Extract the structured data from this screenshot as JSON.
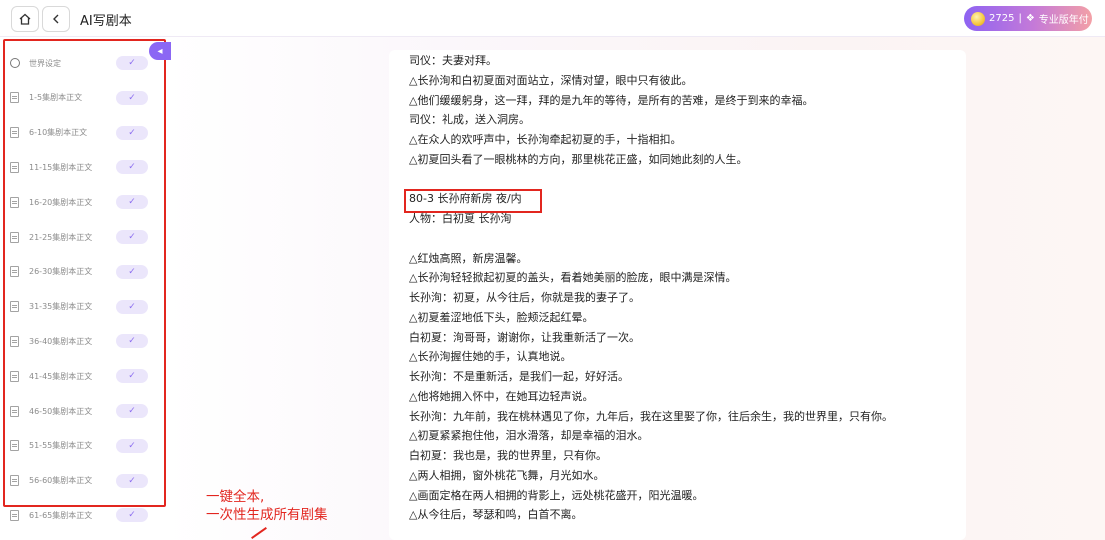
{
  "header": {
    "title": "AI写剧本",
    "home_icon": "home-icon",
    "back_icon": "chevron-left-icon",
    "badge_count": "2725",
    "badge_sep": "|",
    "badge_plan": "专业版年付"
  },
  "sidebar": {
    "items": [
      {
        "label": "世界设定",
        "icon": "world-icon",
        "checked": true
      },
      {
        "label": "1-5集剧本正文",
        "icon": "doc-icon",
        "checked": true
      },
      {
        "label": "6-10集剧本正文",
        "icon": "doc-icon",
        "checked": true
      },
      {
        "label": "11-15集剧本正文",
        "icon": "doc-icon",
        "checked": true
      },
      {
        "label": "16-20集剧本正文",
        "icon": "doc-icon",
        "checked": true
      },
      {
        "label": "21-25集剧本正文",
        "icon": "doc-icon",
        "checked": true
      },
      {
        "label": "26-30集剧本正文",
        "icon": "doc-icon",
        "checked": true
      },
      {
        "label": "31-35集剧本正文",
        "icon": "doc-icon",
        "checked": true
      },
      {
        "label": "36-40集剧本正文",
        "icon": "doc-icon",
        "checked": true
      },
      {
        "label": "41-45集剧本正文",
        "icon": "doc-icon",
        "checked": true
      },
      {
        "label": "46-50集剧本正文",
        "icon": "doc-icon",
        "checked": true
      },
      {
        "label": "51-55集剧本正文",
        "icon": "doc-icon",
        "checked": true
      },
      {
        "label": "56-60集剧本正文",
        "icon": "doc-icon",
        "checked": true
      },
      {
        "label": "61-65集剧本正文",
        "icon": "doc-icon",
        "checked": true
      }
    ],
    "check_glyph": "✓",
    "collapse_glyph": "◂"
  },
  "annotation": {
    "line1": "一键全本,",
    "line2": "一次性生成所有剧集"
  },
  "script": {
    "lines": [
      "司仪：夫妻对拜。",
      "△长孙洵和白初夏面对面站立，深情对望，眼中只有彼此。",
      "△他们缓缓躬身，这一拜，拜的是九年的等待，是所有的苦难，是终于到来的幸福。",
      "司仪：礼成，送入洞房。",
      "△在众人的欢呼声中，长孙洵牵起初夏的手，十指相扣。",
      "△初夏回头看了一眼桃林的方向，那里桃花正盛，如同她此刻的人生。",
      "",
      "80-3 长孙府新房 夜/内",
      "人物：白初夏 长孙洵",
      "",
      "△红烛高照，新房温馨。",
      "△长孙洵轻轻掀起初夏的盖头，看着她美丽的脸庞，眼中满是深情。",
      "长孙洵：初夏，从今往后，你就是我的妻子了。",
      "△初夏羞涩地低下头，脸颊泛起红晕。",
      "白初夏：洵哥哥，谢谢你，让我重新活了一次。",
      "△长孙洵握住她的手，认真地说。",
      "长孙洵：不是重新活，是我们一起，好好活。",
      "△他将她拥入怀中，在她耳边轻声说。",
      "长孙洵：九年前，我在桃林遇见了你，九年后，我在这里娶了你，往后余生，我的世界里，只有你。",
      "△初夏紧紧抱住他，泪水滑落，却是幸福的泪水。",
      "白初夏：我也是，我的世界里，只有你。",
      "△两人相拥，窗外桃花飞舞，月光如水。",
      "△画面定格在两人相拥的背影上，远处桃花盛开，阳光温暖。",
      "△从今往后，琴瑟和鸣，白首不离。"
    ]
  },
  "colors": {
    "accent": "#8b67f4",
    "annotation": "#e2261f"
  }
}
